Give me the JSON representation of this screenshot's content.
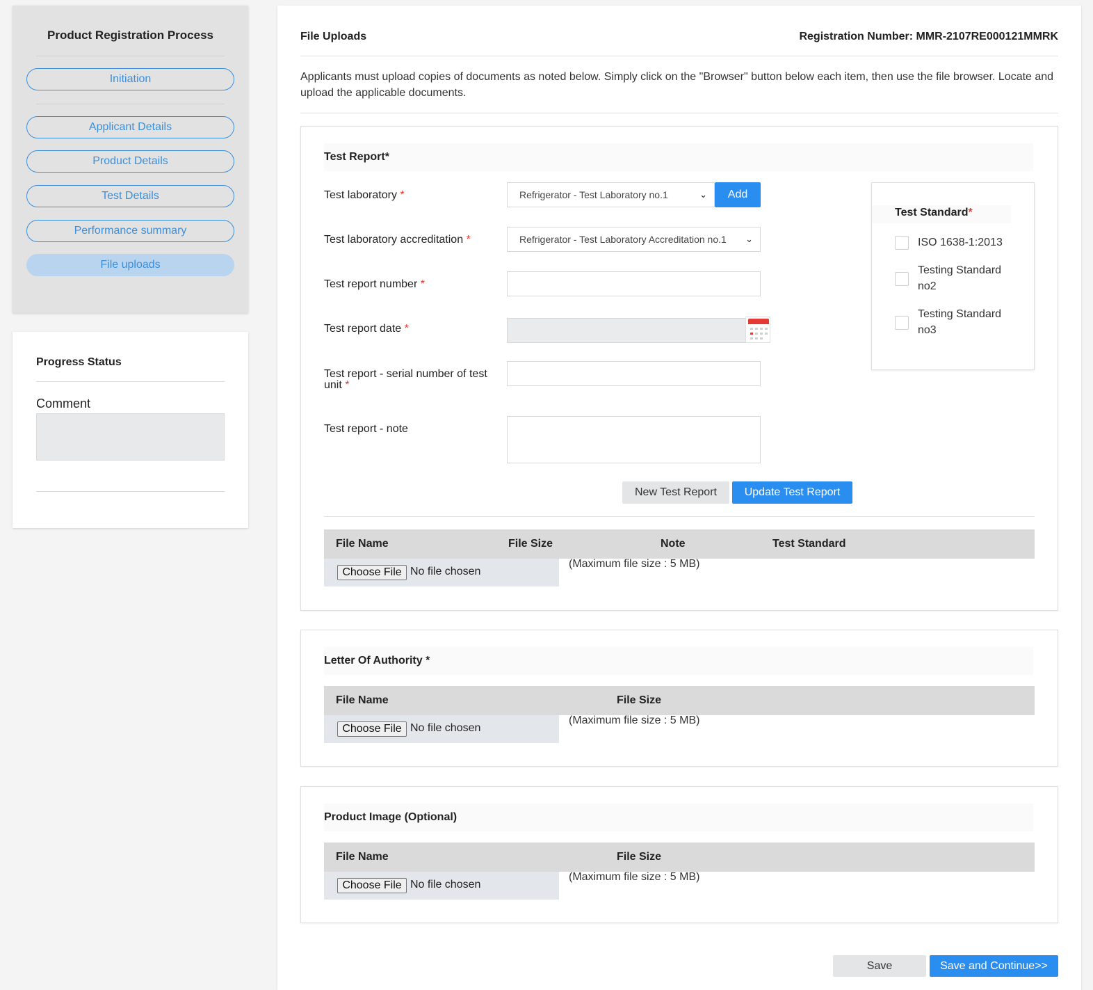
{
  "sidebar": {
    "title": "Product Registration Process",
    "steps": [
      {
        "label": "Initiation"
      },
      {
        "label": "Applicant Details"
      },
      {
        "label": "Product Details"
      },
      {
        "label": "Test Details"
      },
      {
        "label": "Performance summary"
      },
      {
        "label": "File uploads"
      }
    ],
    "active_step": "File uploads"
  },
  "progress": {
    "title": "Progress Status",
    "comment_label": "Comment",
    "comment_value": ""
  },
  "header": {
    "title": "File Uploads",
    "registration": "Registration Number: MMR-2107RE000121MMRK"
  },
  "intro": "Applicants must upload copies of documents as noted below. Simply click on the \"Browser\" button below each item, then use the file browser. Locate and upload the applicable documents.",
  "test_report": {
    "heading": "Test Report*",
    "lab_label": "Test laboratory",
    "lab_value": "Refrigerator - Test Laboratory no.1",
    "add_label": "Add",
    "accreditation_label": "Test laboratory accreditation",
    "accreditation_value": "Refrigerator - Test Laboratory Accreditation no.1",
    "number_label": "Test report number",
    "number_value": "",
    "date_label": "Test report date",
    "date_value": "",
    "serial_label_1": "Test report - serial number of test",
    "serial_label_2": "unit",
    "serial_value": "",
    "note_label": "Test report - note",
    "note_value": "",
    "required_mark": "*",
    "new_btn": "New Test Report",
    "update_btn": "Update Test Report",
    "standards": {
      "title": "Test Standard",
      "items": [
        {
          "label": "ISO 1638-1:2013",
          "checked": false
        },
        {
          "label": "Testing Standard no2",
          "checked": false
        },
        {
          "label": "Testing Standard no3",
          "checked": false
        }
      ]
    },
    "table": {
      "columns": [
        "File Name",
        "File Size",
        "Note",
        "Test Standard"
      ]
    }
  },
  "letter": {
    "heading": "Letter Of Authority *",
    "columns": [
      "File Name",
      "File Size"
    ]
  },
  "product_image": {
    "heading": "Product Image (Optional)",
    "columns": [
      "File Name",
      "File Size"
    ]
  },
  "file_input": {
    "choose_label": "Choose File",
    "no_file": "No file chosen",
    "max_size": "(Maximum file size : 5 MB)"
  },
  "footer": {
    "save": "Save",
    "save_continue": "Save and Continue>>"
  },
  "colors": {
    "accent": "#2a8ef0",
    "nav_outline": "#3a8fdc",
    "required": "#e53935"
  }
}
